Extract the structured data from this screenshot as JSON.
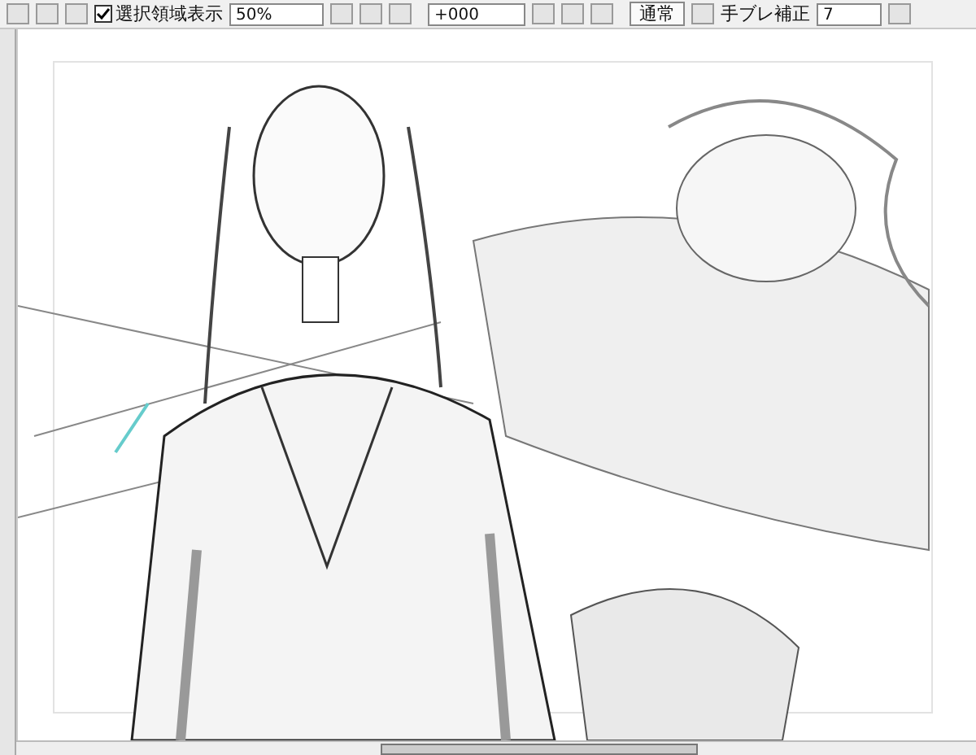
{
  "toolbar": {
    "selection_display": {
      "label": "選択領域表示",
      "checked": true
    },
    "zoom": "50%",
    "rotation": "+000",
    "blend_mode": "通常",
    "stabilizer": {
      "label": "手ブレ補正",
      "value": "7"
    }
  }
}
